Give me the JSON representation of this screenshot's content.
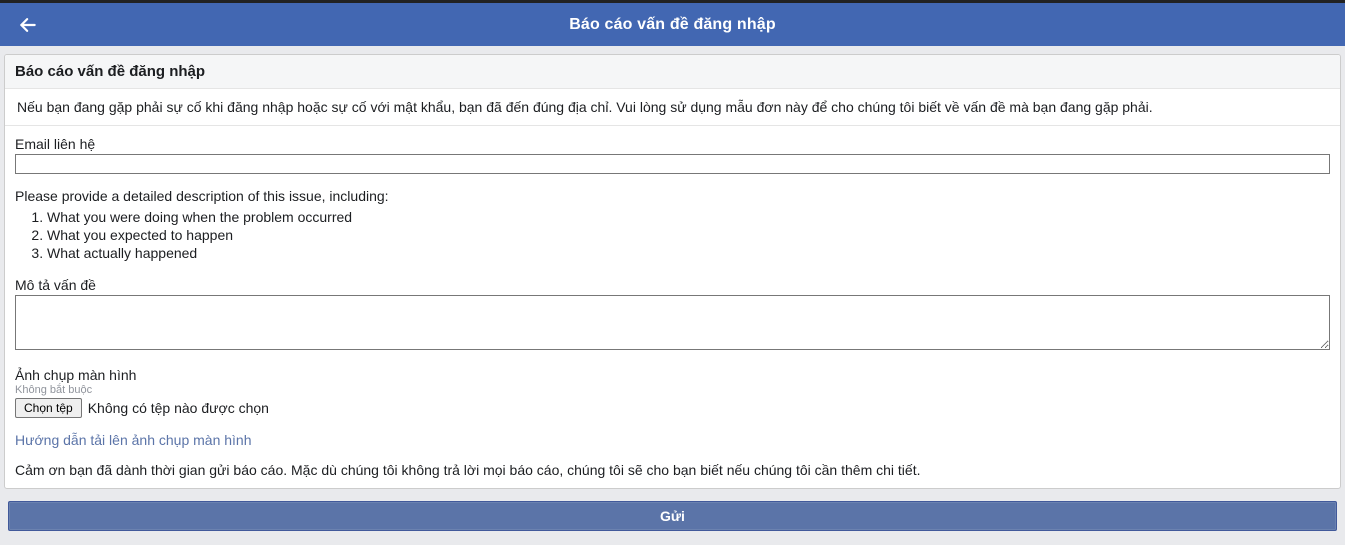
{
  "header": {
    "title": "Báo cáo vấn đề đăng nhập"
  },
  "card": {
    "title": "Báo cáo vấn đề đăng nhập",
    "description": "Nếu bạn đang gặp phải sự cố khi đăng nhập hoặc sự cố với mật khẩu, bạn đã đến đúng địa chỉ. Vui lòng sử dụng mẫu đơn này để cho chúng tôi biết về vấn đề mà bạn đang gặp phải."
  },
  "form": {
    "email_label": "Email liên hệ",
    "email_value": "",
    "instructions_label": "Please provide a detailed description of this issue, including:",
    "instructions_items": [
      "What you were doing when the problem occurred",
      "What you expected to happen",
      "What actually happened"
    ],
    "problem_label": "Mô tả vấn đề",
    "problem_value": "",
    "screenshot_label": "Ảnh chụp màn hình",
    "optional_note": "Không bắt buộc",
    "file_button_label": "Chọn tệp",
    "file_status": "Không có tệp nào được chọn",
    "guide_link": "Hướng dẫn tải lên ảnh chụp màn hình",
    "thanks_text": "Cảm ơn bạn đã dành thời gian gửi báo cáo. Mặc dù chúng tôi không trả lời mọi báo cáo, chúng tôi sẽ cho bạn biết nếu chúng tôi cần thêm chi tiết."
  },
  "submit": {
    "label": "Gửi"
  }
}
